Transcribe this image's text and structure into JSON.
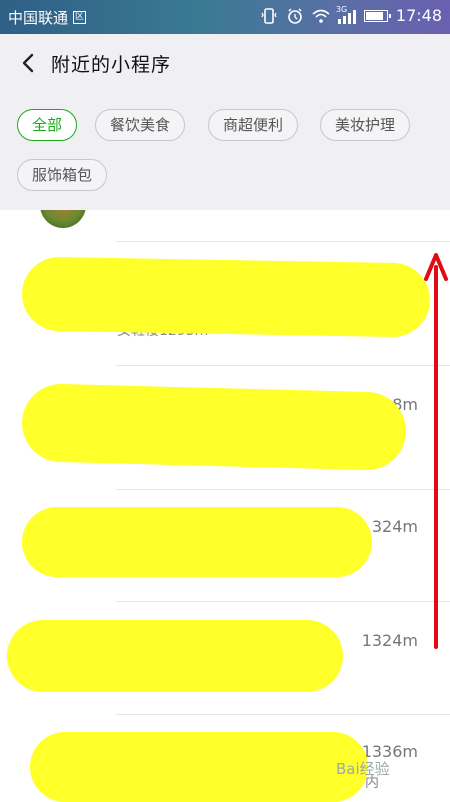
{
  "status_bar": {
    "carrier": "中国联通",
    "carrier_box": "区",
    "network": "3G",
    "time": "17:48"
  },
  "header": {
    "title": "附近的小程序"
  },
  "filters": [
    {
      "label": "全部",
      "selected": true
    },
    {
      "label": "餐饮美食",
      "selected": false
    },
    {
      "label": "商超便利",
      "selected": false
    },
    {
      "label": "美妆护理",
      "selected": false
    },
    {
      "label": "服饰箱包",
      "selected": false
    }
  ],
  "list": {
    "items": [
      {
        "subtext": "女鞋楼1293m"
      },
      {
        "distance": "1308m"
      },
      {
        "distance": "324m"
      },
      {
        "distance": "1324m"
      },
      {
        "distance": "1336m",
        "suffix": "内"
      }
    ]
  },
  "watermark": "Bai经验",
  "colors": {
    "accent": "#1aad19",
    "highlight": "#ffff2a",
    "arrow": "#e00b14"
  }
}
